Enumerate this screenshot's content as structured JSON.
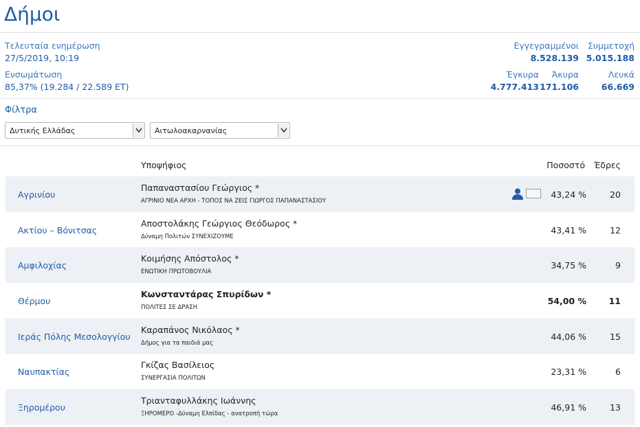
{
  "page": {
    "title": "Δήμοι"
  },
  "stats": {
    "last_update_label": "Τελευταία ενημέρωση",
    "last_update_value": "27/5/2019, 10:19",
    "integration_label": "Ενσωμάτωση",
    "integration_value": "85,37% (19.284 / 22.589 ΕΤ)",
    "registered_label": "Εγγεγραμμένοι",
    "registered_value": "8.528.139",
    "turnout_label": "Συμμετοχή",
    "turnout_value": "5.015.188",
    "valid_label": "Έγκυρα",
    "valid_value": "4.777.413",
    "invalid_label": "Άκυρα",
    "invalid_value": "171.106",
    "blank_label": "Λευκά",
    "blank_value": "66.669"
  },
  "filters": {
    "label": "Φίλτρα",
    "region_selected": "Δυτικής Ελλάδας",
    "unit_selected": "Αιτωλοακαρνανίας"
  },
  "table": {
    "header_candidate": "Υποψήφιος",
    "header_percent": "Ποσοστό",
    "header_seats": "Έδρες",
    "rows": [
      {
        "municipality": "Αγρινίου",
        "candidate": "Παπαναστασίου Γεώργιος *",
        "party": "ΑΓΡΙΝΙΟ ΝΕΑ ΑΡΧΗ - ΤΟΠΟΣ ΝΑ ΖΕΙΣ ΓΙΩΡΓΟΣ ΠΑΠΑΝΑΣΤΑΣΙΟΥ",
        "percent": "43,24 %",
        "seats": "20"
      },
      {
        "municipality": "Ακτίου – Βόνιτσας",
        "candidate": "Αποστολάκης Γεώργιος Θεόδωρος *",
        "party": "Δύναμη Πολιτών ΣΥΝΕΧΙΖΟΥΜΕ",
        "percent": "43,41 %",
        "seats": "12"
      },
      {
        "municipality": "Αμφιλοχίας",
        "candidate": "Κοιμήσης Απόστολος *",
        "party": "ΕΝΩΤΙΚΗ ΠΡΩΤΟΒΟΥΛΙΑ",
        "percent": "34,75 %",
        "seats": "9"
      },
      {
        "municipality": "Θέρμου",
        "candidate": "Κωνσταντάρας Σπυρίδων *",
        "party": "ΠΟΛΙΤΕΣ ΣΕ ΔΡΑΣΗ",
        "percent": "54,00 %",
        "seats": "11"
      },
      {
        "municipality": "Ιεράς Πόλης Μεσολογγίου",
        "candidate": "Καραπάνος Νικόλαος *",
        "party": "Δήμος για τα παιδιά μας",
        "percent": "44,06 %",
        "seats": "15"
      },
      {
        "municipality": "Ναυπακτίας",
        "candidate": "Γκίζας Βασίλειος",
        "party": "ΣΥΝΕΡΓΑΣΙΑ ΠΟΛΙΤΩΝ",
        "percent": "23,31 %",
        "seats": "6"
      },
      {
        "municipality": "Ξηρομέρου",
        "candidate": "Τριανταφυλλάκης Ιωάννης",
        "party": "ΞΗΡΟΜΕΡΟ -Δύναμη Ελπίδας - ανατροπή τώρα",
        "percent": "46,91 %",
        "seats": "13"
      }
    ]
  },
  "colors": {
    "accent": "#1d5ca8",
    "row_alt": "#edf0f5"
  }
}
